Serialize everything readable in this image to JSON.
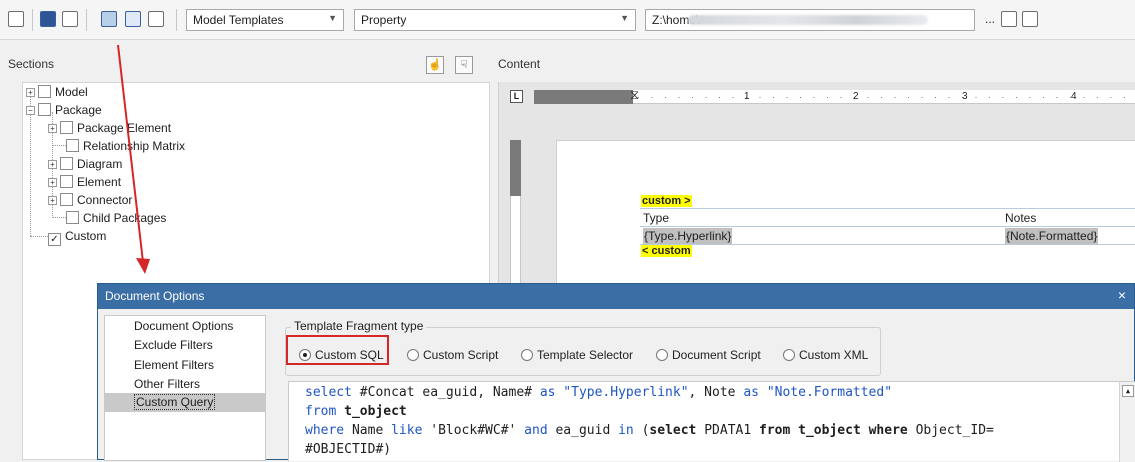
{
  "toolbar": {
    "template_combo": "Model Templates",
    "property_combo": "Property",
    "path_value": "Z:\\home\\",
    "ellipsis": "..."
  },
  "sections": {
    "title": "Sections",
    "tree": [
      {
        "label": "Model",
        "checked": false
      },
      {
        "label": "Package",
        "checked": false
      },
      {
        "label": "Package Element",
        "checked": false
      },
      {
        "label": "Relationship Matrix",
        "checked": false
      },
      {
        "label": "Diagram",
        "checked": false
      },
      {
        "label": "Element",
        "checked": false
      },
      {
        "label": "Connector",
        "checked": false
      },
      {
        "label": "Child Packages",
        "checked": false
      },
      {
        "label": "Custom",
        "checked": true
      }
    ]
  },
  "content": {
    "title": "Content",
    "ruler_numbers": [
      "1",
      "2",
      "3",
      "4"
    ],
    "custom_open": "custom >",
    "custom_close": "< custom",
    "table": {
      "headers": [
        "Type",
        "Notes"
      ],
      "row": [
        "{Type.Hyperlink}",
        "{Note.Formatted}"
      ]
    }
  },
  "dialog": {
    "title": "Document Options",
    "close": "×",
    "nav": [
      "Document Options",
      "Exclude Filters",
      "Element Filters",
      "Other Filters",
      "Custom Query"
    ],
    "selected_nav": "Custom Query",
    "group_label": "Template Fragment type",
    "fragment_types": [
      "Custom SQL",
      "Custom Script",
      "Template Selector",
      "Document Script",
      "Custom XML"
    ],
    "selected_fragment": "Custom SQL",
    "sql_lines": [
      "select #Concat ea_guid, Name# as \"Type.Hyperlink\", Note as \"Note.Formatted\"",
      "from t_object",
      "where Name like 'Block#WC#' and ea_guid in (select PDATA1 from t_object where Object_ID=",
      "#OBJECTID#)"
    ]
  },
  "colors": {
    "title_bar": "#3a6ea5",
    "highlight_red": "#d62728",
    "sql_keyword": "#1e56c4",
    "tag_highlight": "#ffff00"
  }
}
